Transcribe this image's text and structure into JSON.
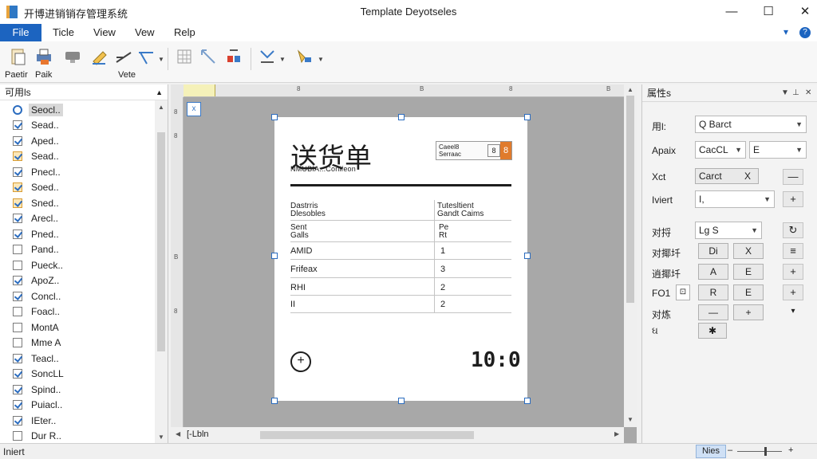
{
  "app": {
    "name": "开博进销销存管理系统",
    "window_title": "Template Deyotseles"
  },
  "window_controls": {
    "minimize": "—",
    "maximize": "☐",
    "close": "✕"
  },
  "menu": {
    "items": [
      "File",
      "Ticle",
      "View",
      "Vew",
      "Relp"
    ],
    "right_glyph": "?",
    "right_caret": "▾"
  },
  "toolbar": {
    "label_paste": "Paetir",
    "label_print": "Paik",
    "label_vote": "Vete"
  },
  "left_panel": {
    "title": "可用ls",
    "items": [
      {
        "label": "Seocl..",
        "state": "search",
        "selected": true
      },
      {
        "label": "Sead..",
        "state": "on"
      },
      {
        "label": "Aped..",
        "state": "on"
      },
      {
        "label": "Sead..",
        "state": "orange"
      },
      {
        "label": "Pnecl..",
        "state": "on"
      },
      {
        "label": "Soed..",
        "state": "orange"
      },
      {
        "label": "Sned..",
        "state": "orange"
      },
      {
        "label": "Arecl..",
        "state": "on"
      },
      {
        "label": "Pned..",
        "state": "on"
      },
      {
        "label": "Pand..",
        "state": "off"
      },
      {
        "label": "Pueck..",
        "state": "off"
      },
      {
        "label": "ApoZ..",
        "state": "on"
      },
      {
        "label": "Concl..",
        "state": "on"
      },
      {
        "label": "Foacl..",
        "state": "off"
      },
      {
        "label": "MontA",
        "state": "off"
      },
      {
        "label": "Mme A",
        "state": "off"
      },
      {
        "label": "Teacl..",
        "state": "on"
      },
      {
        "label": "SoncLL",
        "state": "on"
      },
      {
        "label": "Spind..",
        "state": "on"
      },
      {
        "label": "Puiacl..",
        "state": "on"
      },
      {
        "label": "IEter..",
        "state": "on"
      },
      {
        "label": "Dur R..",
        "state": "off"
      }
    ]
  },
  "canvas": {
    "zoom_label": "[-Lbln",
    "layout_glyph": "x",
    "ruler_top": [
      "8",
      "B",
      "8",
      "B"
    ],
    "ruler_left": [
      "8",
      "8",
      "B",
      "8"
    ]
  },
  "document": {
    "title": "送货单",
    "subtitle": "NMUBIA...Conlfeon",
    "stamp_text": "Caeel8\nSerraac",
    "stamp_box": "8",
    "stamp_badge": "8",
    "header_left": "Dastrris\nDlesobles",
    "header_right": "Tutesltient\nGandt Caims",
    "rows": [
      {
        "left": "Sent\nGalls",
        "right": "Pe\nRt"
      },
      {
        "left": "AMID",
        "right": "1"
      },
      {
        "left": "Frifeax",
        "right": "3"
      },
      {
        "left": "RHI",
        "right": "2"
      },
      {
        "left": "II",
        "right": "2"
      }
    ],
    "clock_glyph": "+",
    "total": "10:0"
  },
  "properties": {
    "title": "属性s",
    "rows": [
      {
        "label": "用l:",
        "field": "Q  Barct"
      },
      {
        "label": "Apaix",
        "field": "CacCL",
        "field2": "E"
      },
      {
        "label": "Xct",
        "button": "Carct",
        "button_x": "X",
        "side": "—"
      },
      {
        "label": "Iviert",
        "field": "I,",
        "side": "+"
      },
      {
        "label": "对捋",
        "field": "Lg  S",
        "side": "↻"
      },
      {
        "label": "对揶圲",
        "btn1": "Di",
        "btn2": "X",
        "side": "≡"
      },
      {
        "label": "逍揶圲",
        "btn1": "A",
        "btn2": "E",
        "side": "+"
      },
      {
        "label": "FO1",
        "btn1": "R",
        "btn2": "E",
        "side": "+"
      },
      {
        "label": "对炼",
        "btn1": "—",
        "btn2": "+",
        "side": "▾"
      },
      {
        "label": "ઘ",
        "btn1": "✱"
      }
    ],
    "small_glyph": "⊡"
  },
  "status": {
    "text": "Iniert",
    "button": "Nies",
    "zoom_minus": "–",
    "zoom_plus": "+"
  }
}
